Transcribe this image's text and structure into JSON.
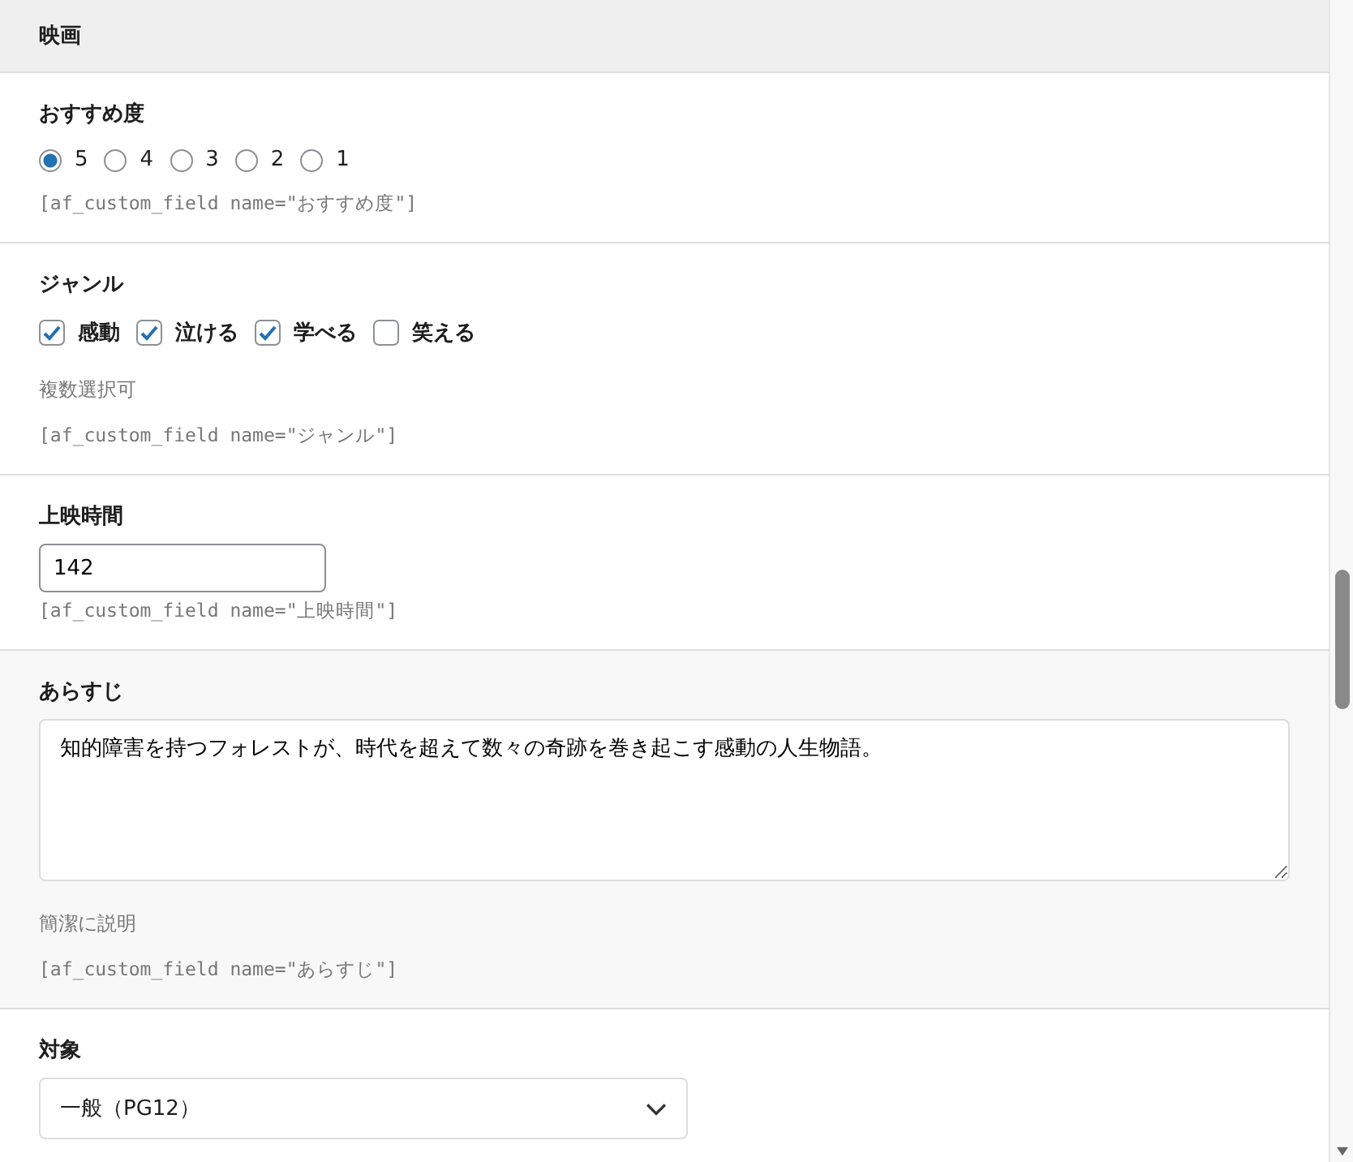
{
  "header": {
    "title": "映画"
  },
  "fields": [
    {
      "kind": "radio",
      "label": "おすすめ度",
      "options": [
        {
          "label": "5",
          "selected": true
        },
        {
          "label": "4",
          "selected": false
        },
        {
          "label": "3",
          "selected": false
        },
        {
          "label": "2",
          "selected": false
        },
        {
          "label": "1",
          "selected": false
        }
      ],
      "shortcode": "[af_custom_field name=\"おすすめ度\"]"
    },
    {
      "kind": "checkbox",
      "label": "ジャンル",
      "options": [
        {
          "label": "感動",
          "checked": true
        },
        {
          "label": "泣ける",
          "checked": true
        },
        {
          "label": "学べる",
          "checked": true
        },
        {
          "label": "笑える",
          "checked": false
        }
      ],
      "hint": "複数選択可",
      "shortcode": "[af_custom_field name=\"ジャンル\"]"
    },
    {
      "kind": "number",
      "label": "上映時間",
      "value": "142",
      "shortcode": "[af_custom_field name=\"上映時間\"]"
    },
    {
      "kind": "textarea",
      "label": "あらすじ",
      "value": "知的障害を持つフォレストが、時代を超えて数々の奇跡を巻き起こす感動の人生物語。",
      "hint": "簡潔に説明",
      "shortcode": "[af_custom_field name=\"あらすじ\"]"
    },
    {
      "kind": "select",
      "label": "対象",
      "value": "一般（PG12）"
    }
  ]
}
